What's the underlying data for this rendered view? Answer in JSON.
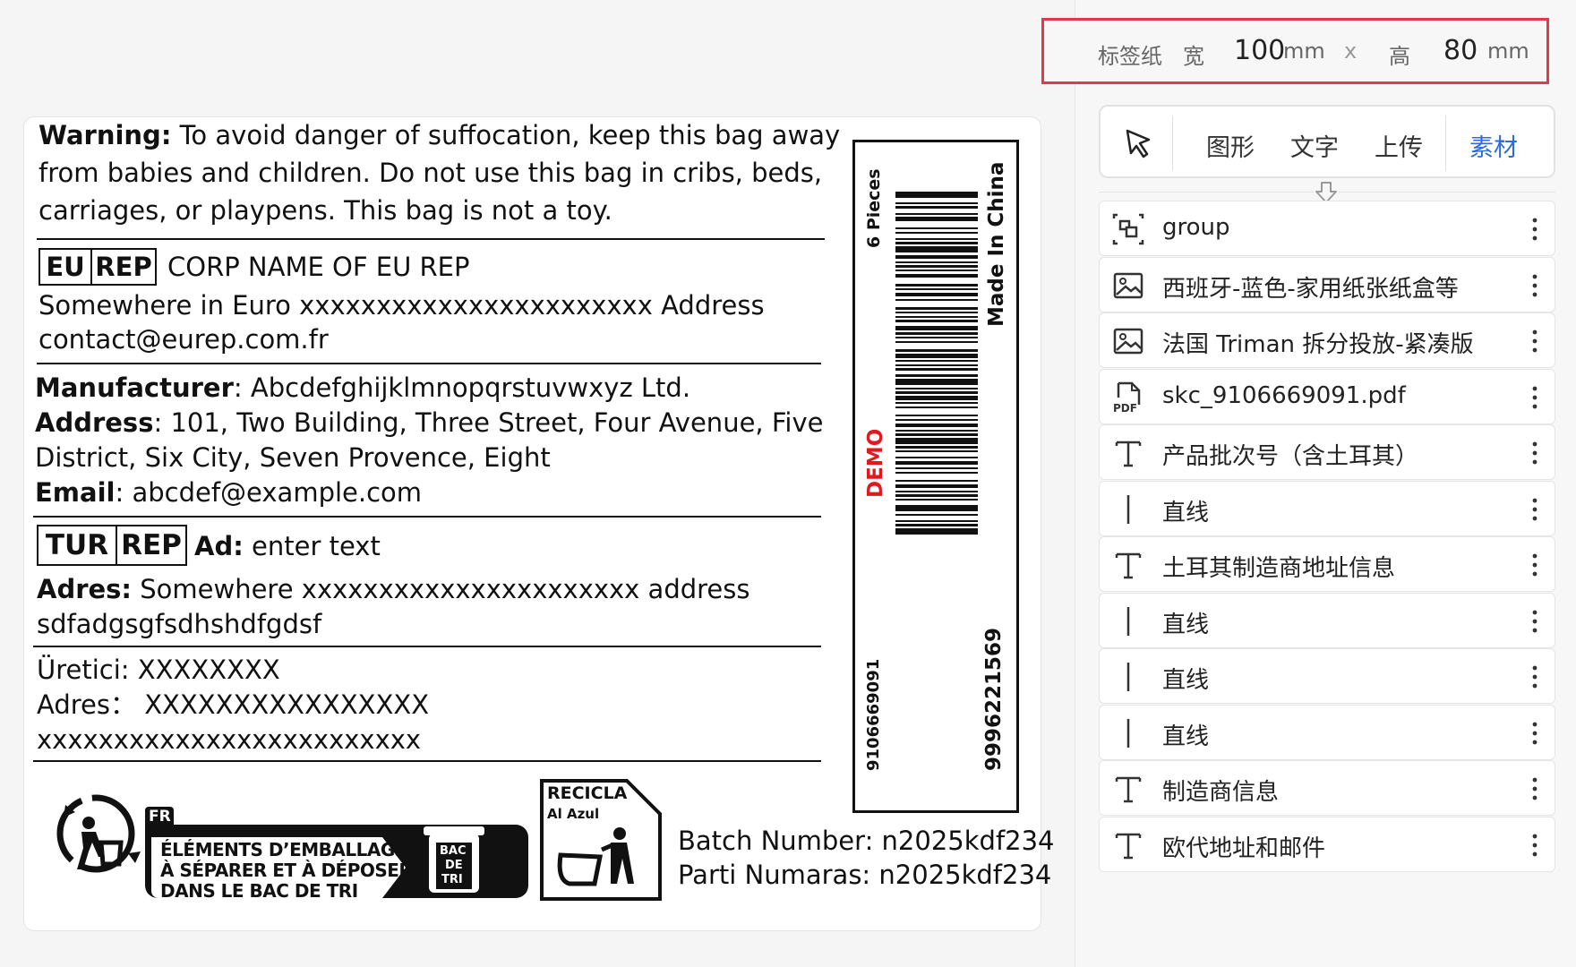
{
  "label": {
    "warning_label": "Warning:",
    "warning_lines": [
      "To avoid danger of suffocation, keep this bag away",
      "from babies and children. Do not use this bag in cribs, beds,",
      "carriages, or playpens. This bag is not a toy."
    ],
    "eu_rep_box": [
      "EU",
      "REP"
    ],
    "eu_rep_name": "CORP NAME OF EU REP",
    "eu_rep_address": "Somewhere in Euro xxxxxxxxxxxxxxxxxxxxxxx Address",
    "eu_rep_contact": "contact@eurep.com.fr",
    "manufacturer_label": "Manufacturer",
    "manufacturer_value": ": Abcdefghijklmnopqrstuvwxyz Ltd.",
    "address_label": "Address",
    "address_value_1": ": 101, Two Building, Three Street, Four Avenue, Five",
    "address_value_2": "District, Six City, Seven Provence, Eight",
    "email_label": "Email",
    "email_value": ": abcdef@example.com",
    "tur_rep_box": [
      "TUR",
      "REP"
    ],
    "ad_label": "Ad:",
    "ad_value": " enter text",
    "adres_label": "Adres:",
    "adres_value_1": " Somewhere xxxxxxxxxxxxxxxxxxxxxx address",
    "adres_value_2": "sdfadgsgfsdhshdfgdsf",
    "uretici_line": "Üretici: XXXXXXXX",
    "adres_line": "Adres： XXXXXXXXXXXXXXXX",
    "x_line": "xxxxxxxxxxxxxxxxxxxxxxxxx",
    "barcode": {
      "pieces": "6 Pieces",
      "origin": "Made In China",
      "demo": "DEMO",
      "left_number": "9106669091",
      "right_number": "9996221569"
    },
    "triman": {
      "fr_tag": "FR",
      "line1": "ÉLÉMENTS D’EMBALLAGE",
      "line2": "À SÉPARER ET À DÉPOSER",
      "line3": "DANS LE BAC DE TRI",
      "bin_text": [
        "BAC",
        "DE",
        "TRI"
      ]
    },
    "recicla": {
      "title": "RECICLA",
      "subtitle": "Al Azul"
    },
    "batch_line": "Batch Number: n2025kdf234",
    "parti_line": "Parti Numaras: n2025kdf234"
  },
  "size_bar": {
    "paper_label": "标签纸",
    "width_label": "宽",
    "width_value": "100",
    "unit": "mm",
    "times": "x",
    "height_label": "高",
    "height_value": "80"
  },
  "toolbar": {
    "tabs": [
      "图形",
      "文字",
      "上传",
      "素材"
    ],
    "active_tab": "素材"
  },
  "layers": [
    {
      "icon": "group-icon",
      "label": "group"
    },
    {
      "icon": "image-icon",
      "label": "西班牙-蓝色-家用纸张纸盒等"
    },
    {
      "icon": "image-icon",
      "label": "法国 Triman 拆分投放-紧凑版"
    },
    {
      "icon": "pdf-icon",
      "label": "skc_9106669091.pdf"
    },
    {
      "icon": "text-icon",
      "label": "产品批次号（含土耳其）"
    },
    {
      "icon": "line-icon",
      "label": "直线"
    },
    {
      "icon": "text-icon",
      "label": "土耳其制造商地址信息"
    },
    {
      "icon": "line-icon",
      "label": "直线"
    },
    {
      "icon": "line-icon",
      "label": "直线"
    },
    {
      "icon": "line-icon",
      "label": "直线"
    },
    {
      "icon": "text-icon",
      "label": "制造商信息"
    },
    {
      "icon": "text-icon",
      "label": "欧代地址和邮件"
    }
  ],
  "colors": {
    "highlight_border": "#e03a45",
    "active_tab": "#2f6bd8",
    "demo_text": "#e0191e"
  }
}
